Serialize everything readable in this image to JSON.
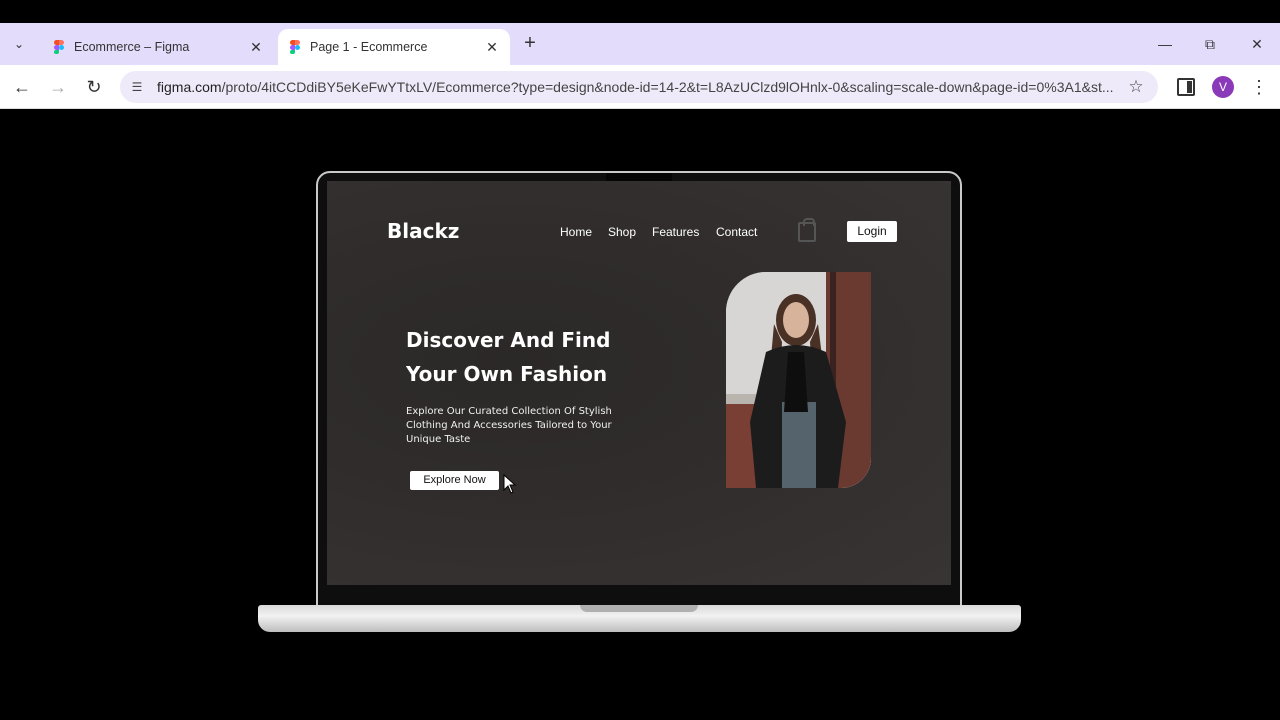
{
  "browser": {
    "tabs": [
      {
        "title": "Ecommerce – Figma",
        "active": false
      },
      {
        "title": "Page 1 - Ecommerce",
        "active": true
      }
    ],
    "url_host": "figma.com",
    "url_path": "/proto/4itCCDdiBY5eKeFwYTtxLV/Ecommerce?type=design&node-id=14-2&t=L8AzUClzd9lOHnlx-0&scaling=scale-down&page-id=0%3A1&st...",
    "profile_initial": "V",
    "icons": {
      "back": "arrow-left-icon",
      "forward": "arrow-right-icon",
      "reload": "reload-icon",
      "site_info": "tune-icon",
      "bookmark": "star-icon",
      "sidepanel": "side-panel-icon",
      "menu": "kebab-menu-icon"
    }
  },
  "site": {
    "brand": "Blackz",
    "nav": [
      "Home",
      "Shop",
      "Features",
      "Contact"
    ],
    "login_label": "Login",
    "hero_title_line1": "Discover And Find",
    "hero_title_line2": "Your Own Fashion",
    "hero_sub_line1": "Explore Our Curated Collection Of Stylish",
    "hero_sub_line2": "Clothing And Accessories Tailored to Your",
    "hero_sub_line3": "Unique Taste",
    "explore_label": "Explore Now",
    "bag_icon": "shopping-bag-icon"
  },
  "colors": {
    "tabbar": "#e4dcfb",
    "screen_bg": "#302c2c",
    "avatar": "#8a3ab9"
  }
}
